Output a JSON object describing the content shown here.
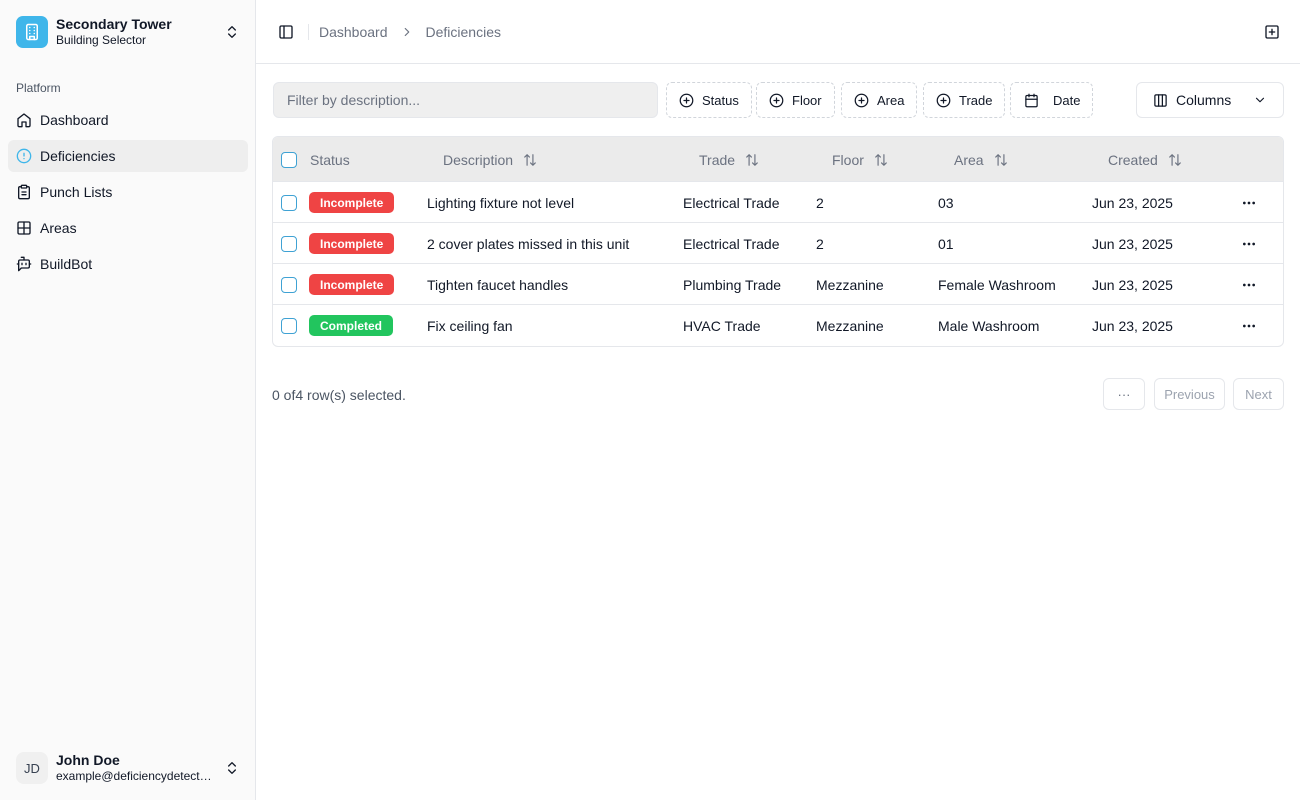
{
  "colors": {
    "accent": "#3fb6ea",
    "incomplete": "#ef4444",
    "completed": "#22c55e"
  },
  "sidebar": {
    "building": {
      "name": "Secondary Tower",
      "subtitle": "Building Selector",
      "icon": "building-icon"
    },
    "group_label": "Platform",
    "items": [
      {
        "label": "Dashboard",
        "icon": "home-icon"
      },
      {
        "label": "Deficiencies",
        "icon": "alert-circle-icon",
        "active": true
      },
      {
        "label": "Punch Lists",
        "icon": "clipboard-icon"
      },
      {
        "label": "Areas",
        "icon": "layout-grid-icon"
      },
      {
        "label": "BuildBot",
        "icon": "bot-message-icon"
      }
    ],
    "user": {
      "initials": "JD",
      "name": "John Doe",
      "email": "example@deficiencydetect...."
    }
  },
  "header": {
    "breadcrumbs": [
      "Dashboard",
      "Deficiencies"
    ]
  },
  "toolbar": {
    "filter_placeholder": "Filter by description...",
    "filter_value": "",
    "filters": [
      "Status",
      "Floor",
      "Area",
      "Trade",
      "Date"
    ],
    "columns_label": "Columns"
  },
  "table": {
    "headers": {
      "status": "Status",
      "description": "Description",
      "trade": "Trade",
      "floor": "Floor",
      "area": "Area",
      "created": "Created"
    },
    "rows": [
      {
        "status": "Incomplete",
        "description": "Lighting fixture not level",
        "trade": "Electrical Trade",
        "floor": "2",
        "area": "03",
        "created": "Jun 23, 2025"
      },
      {
        "status": "Incomplete",
        "description": "2 cover plates missed in this unit",
        "trade": "Electrical Trade",
        "floor": "2",
        "area": "01",
        "created": "Jun 23, 2025"
      },
      {
        "status": "Incomplete",
        "description": "Tighten faucet handles",
        "trade": "Plumbing Trade",
        "floor": "Mezzanine",
        "area": "Female Washroom",
        "created": "Jun 23, 2025"
      },
      {
        "status": "Completed",
        "description": "Fix ceiling fan",
        "trade": "HVAC Trade",
        "floor": "Mezzanine",
        "area": "Male Washroom",
        "created": "Jun 23, 2025"
      }
    ]
  },
  "footer": {
    "selection_text": "0 of4 row(s) selected.",
    "ellipsis": "···",
    "previous": "Previous",
    "next": "Next"
  }
}
